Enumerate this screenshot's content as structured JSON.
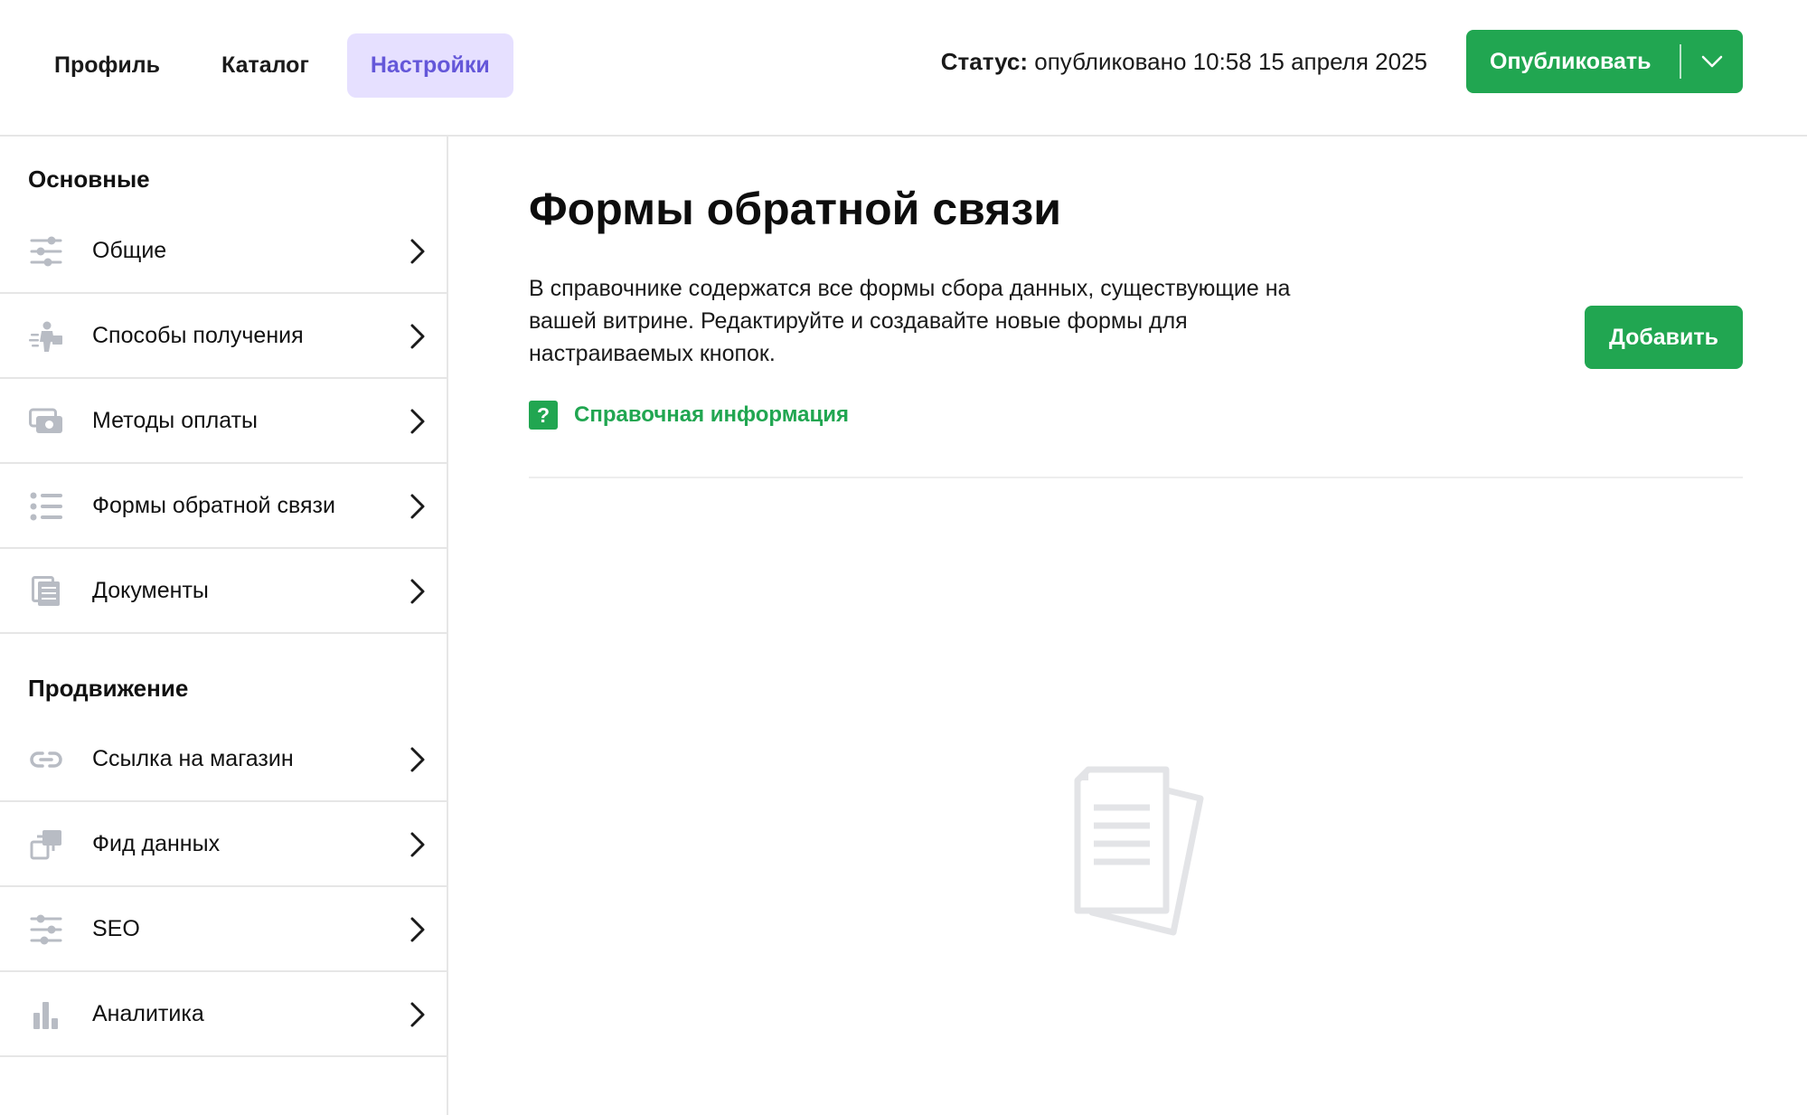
{
  "header": {
    "tabs": [
      {
        "label": "Профиль",
        "active": false
      },
      {
        "label": "Каталог",
        "active": false
      },
      {
        "label": "Настройки",
        "active": true
      }
    ],
    "status_label": "Статус:",
    "status_value": " опубликовано 10:58 15 апреля 2025",
    "publish_label": "Опубликовать",
    "publish_caret_icon": "chevron-down-icon"
  },
  "sidebar": {
    "sections": [
      {
        "title": "Основные",
        "items": [
          {
            "label": "Общие",
            "icon": "sliders-icon"
          },
          {
            "label": "Способы получения",
            "icon": "courier-icon"
          },
          {
            "label": "Методы оплаты",
            "icon": "money-icon"
          },
          {
            "label": "Формы обратной связи",
            "icon": "list-icon"
          },
          {
            "label": "Документы",
            "icon": "documents-icon"
          }
        ]
      },
      {
        "title": "Продвижение",
        "items": [
          {
            "label": "Ссылка на магазин",
            "icon": "link-icon"
          },
          {
            "label": "Фид данных",
            "icon": "feed-icon"
          },
          {
            "label": "SEO",
            "icon": "sliders-icon"
          },
          {
            "label": "Аналитика",
            "icon": "bar-chart-icon"
          }
        ]
      }
    ]
  },
  "main": {
    "title": "Формы обратной связи",
    "description": "В справочнике содержатся все формы сбора данных, существующие на вашей витрине. Редактируйте и создавайте новые формы для настраиваемых кнопок.",
    "add_button_label": "Добавить",
    "help_icon_glyph": "?",
    "help_link_label": "Справочная информация",
    "empty_state_icon": "empty-documents-icon"
  },
  "colors": {
    "accent_green": "#21a651",
    "active_tab_bg": "#e6e0ff",
    "active_tab_text": "#6457d9",
    "icon_gray": "#b8bcc4",
    "divider": "#e6e6e6"
  }
}
